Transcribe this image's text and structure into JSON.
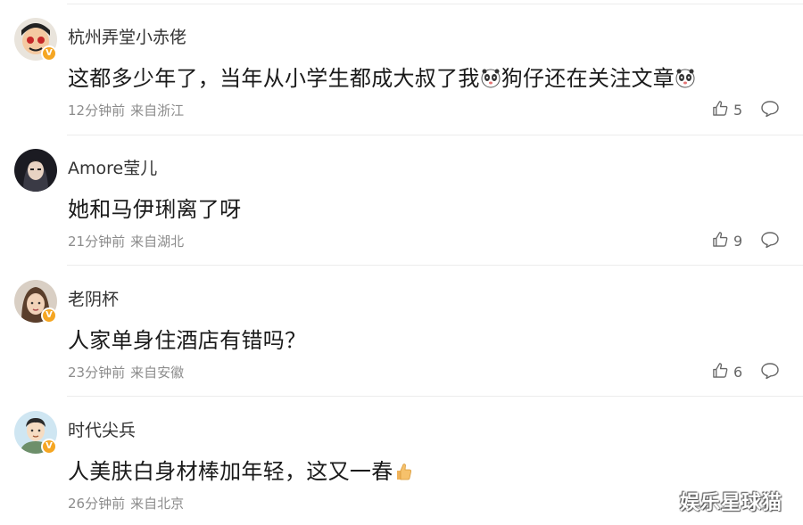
{
  "comments": [
    {
      "username": "杭州弄堂小赤佬",
      "text_parts": [
        "这都多少年了，当年从小学生都成大叔了我",
        "狗仔还在关注文章"
      ],
      "emoji": "panda-emoji",
      "time": "12分钟前",
      "location": "来自浙江",
      "likes": "5",
      "verified": true
    },
    {
      "username": "Amore莹儿",
      "text_parts": [
        "她和马伊琍离了呀"
      ],
      "time": "21分钟前",
      "location": "来自湖北",
      "likes": "9",
      "verified": false
    },
    {
      "username": "老阴杯",
      "text_parts": [
        "人家单身住酒店有错吗？"
      ],
      "time": "23分钟前",
      "location": "来自安徽",
      "likes": "6",
      "verified": true
    },
    {
      "username": "时代尖兵",
      "text_parts": [
        "人美肤白身材棒加年轻，这又一春"
      ],
      "emoji": "thumbs-up-emoji",
      "time": "26分钟前",
      "location": "来自北京",
      "verified": true
    }
  ],
  "watermark": "娱乐星球猫",
  "colors": {
    "badge": "#f5a623",
    "meta": "#8c8c8c",
    "text": "#1a1a1a"
  }
}
